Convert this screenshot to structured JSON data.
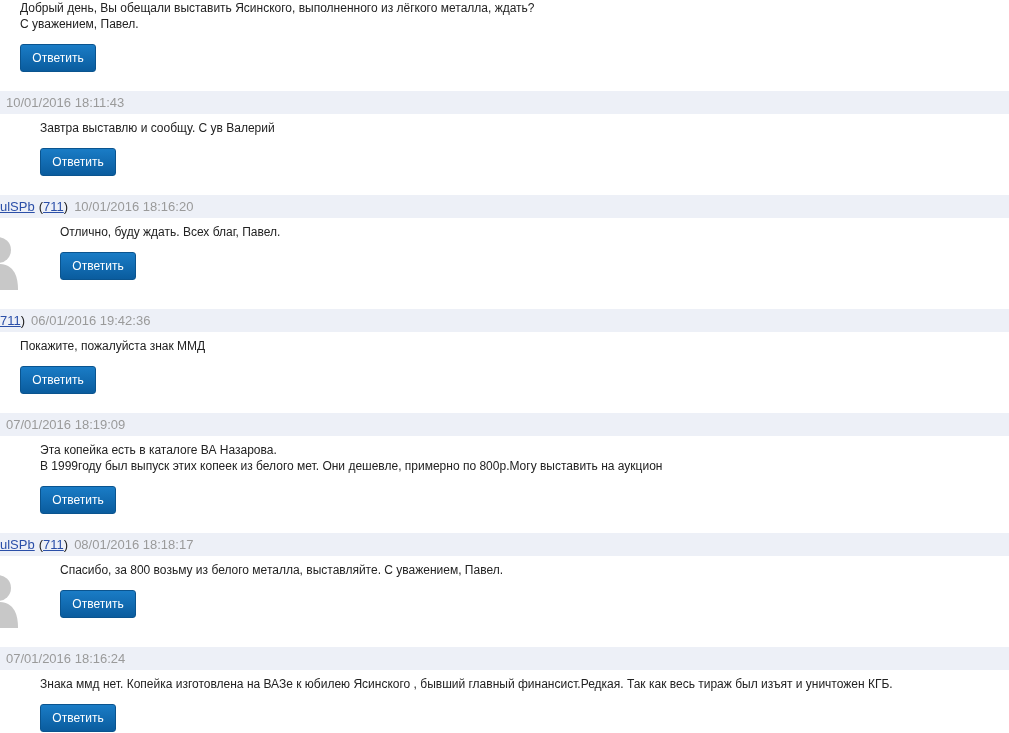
{
  "posts": [
    {
      "lines": [
        "Добрый день, Вы обещали выставить Ясинского, выполненного из лёгкого металла, ждать?",
        "С уважением, Павел."
      ],
      "button": "Ответить",
      "children": [
        {
          "header": [
            {
              "kind": "date",
              "text": "10/01/2016 18:11:43"
            }
          ],
          "lines": [
            "Завтра выставлю и сообщу. С ув Валерий"
          ],
          "button": "Ответить",
          "children": [
            {
              "header": [
                {
                  "kind": "link",
                  "text": "ulSPb"
                },
                {
                  "kind": "text",
                  "text": "("
                },
                {
                  "kind": "link",
                  "text": "711"
                },
                {
                  "kind": "text",
                  "text": ")"
                },
                {
                  "kind": "date",
                  "text": "10/01/2016 18:16:20"
                }
              ],
              "lines": [
                "Отлично, буду ждать. Всех благ, Павел."
              ],
              "avatar": true,
              "button": "Ответить"
            }
          ]
        }
      ]
    },
    {
      "header": [
        {
          "kind": "link",
          "text": "711"
        },
        {
          "kind": "text",
          "text": ")"
        },
        {
          "kind": "date",
          "text": "06/01/2016 19:42:36"
        }
      ],
      "lines": [
        "Покажите, пожалуйста знак ММД"
      ],
      "button": "Ответить",
      "children": [
        {
          "header": [
            {
              "kind": "date",
              "text": "07/01/2016 18:19:09"
            }
          ],
          "lines": [
            "Эта копейка есть в каталоге ВА Назарова.",
            "В 1999году был выпуск этих копеек из белого мет. Они дешевле, примерно по 800р.Могу выставить на аукцион"
          ],
          "button": "Ответить",
          "children": [
            {
              "header": [
                {
                  "kind": "link",
                  "text": "ulSPb"
                },
                {
                  "kind": "text",
                  "text": "("
                },
                {
                  "kind": "link",
                  "text": "711"
                },
                {
                  "kind": "text",
                  "text": ")"
                },
                {
                  "kind": "date",
                  "text": "08/01/2016 18:18:17"
                }
              ],
              "lines": [
                "Спасибо, за 800 возьму из белого металла, выставляйте. С уважением, Павел."
              ],
              "avatar": true,
              "button": "Ответить"
            }
          ]
        },
        {
          "header": [
            {
              "kind": "date",
              "text": "07/01/2016 18:16:24"
            }
          ],
          "lines": [
            "Знака ммд нет. Копейка изготовлена на ВАЗе к юбилею Ясинского , бывший главный финансист.Редкая. Так как весь тираж был изъят и уничтожен КГБ."
          ],
          "button": "Ответить"
        }
      ]
    }
  ]
}
